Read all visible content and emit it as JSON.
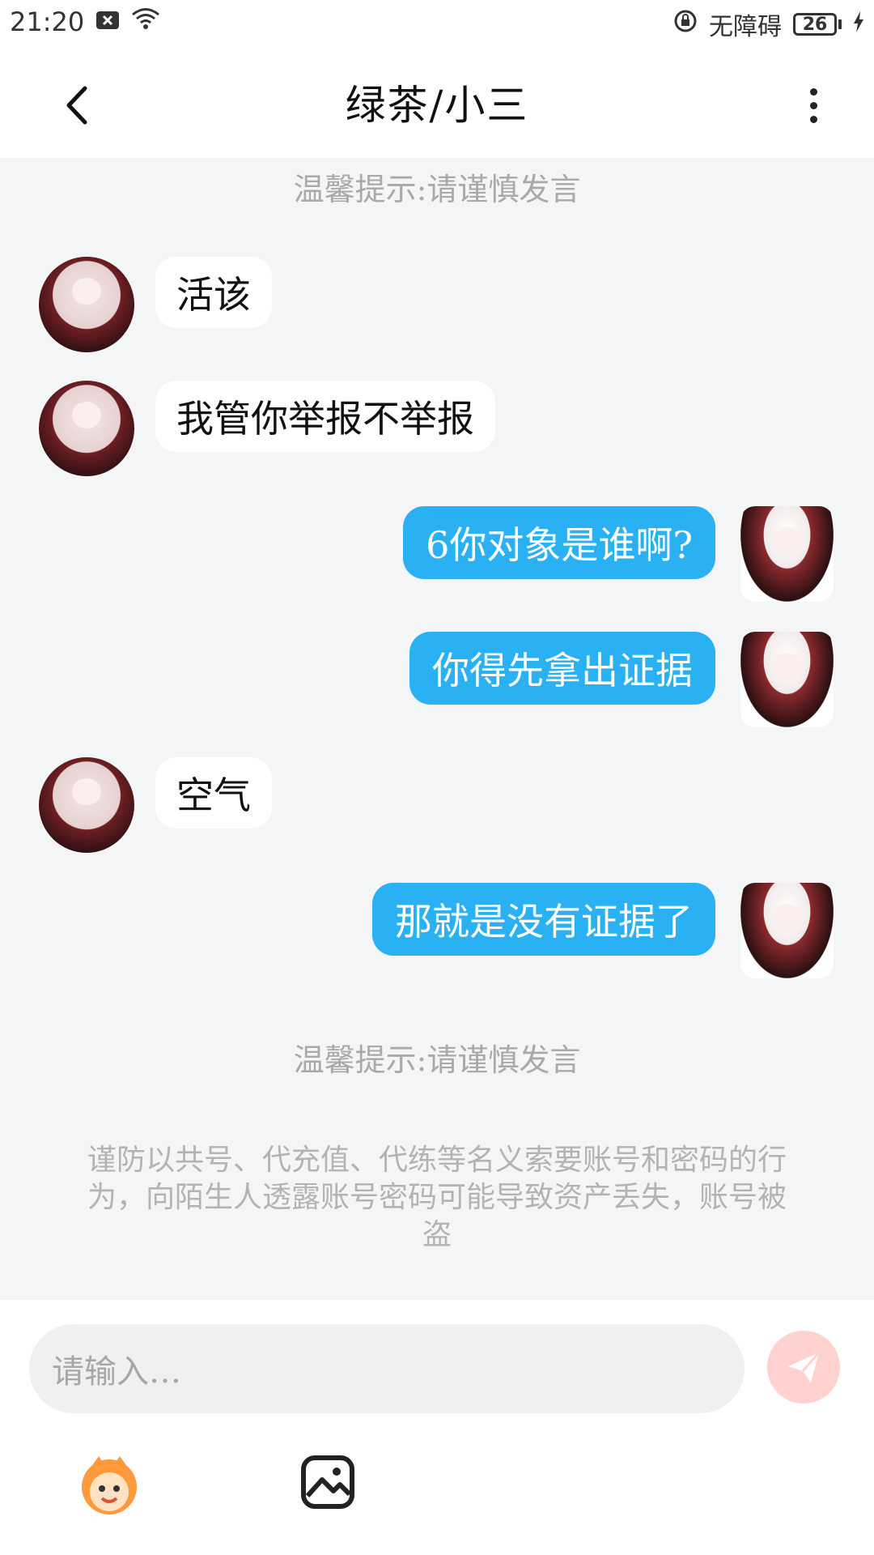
{
  "status_bar": {
    "time": "21:20",
    "accessibility_label": "无障碍",
    "battery_level": "26",
    "icons": [
      "notification-x-icon",
      "wifi-icon",
      "lock-rotation-icon",
      "battery-icon",
      "charging-icon"
    ]
  },
  "header": {
    "title": "绿茶/小三",
    "back_icon": "chevron-left-icon",
    "more_icon": "more-vertical-icon"
  },
  "notices": {
    "top": "温馨提示:请谨慎发言",
    "bottom": "温馨提示:请谨慎发言"
  },
  "messages": [
    {
      "side": "left",
      "text": "活该"
    },
    {
      "side": "left",
      "text": "我管你举报不举报"
    },
    {
      "side": "right",
      "text": "6你对象是谁啊?"
    },
    {
      "side": "right",
      "text": "你得先拿出证据"
    },
    {
      "side": "left",
      "text": "空气"
    },
    {
      "side": "right",
      "text": "那就是没有证据了"
    }
  ],
  "security_note": "谨防以共号、代充值、代练等名义索要账号和密码的行为，向陌生人透露账号密码可能导致资产丢失，账号被盗",
  "input": {
    "placeholder": "请输入…",
    "send_icon": "send-icon",
    "emoji_icon": "mascot-emoji-icon",
    "image_icon": "image-icon"
  },
  "colors": {
    "outgoing_bubble": "#29b1f3",
    "incoming_bubble": "#ffffff",
    "chat_background": "#f4f5f7",
    "send_button": "#ffd1cf"
  }
}
